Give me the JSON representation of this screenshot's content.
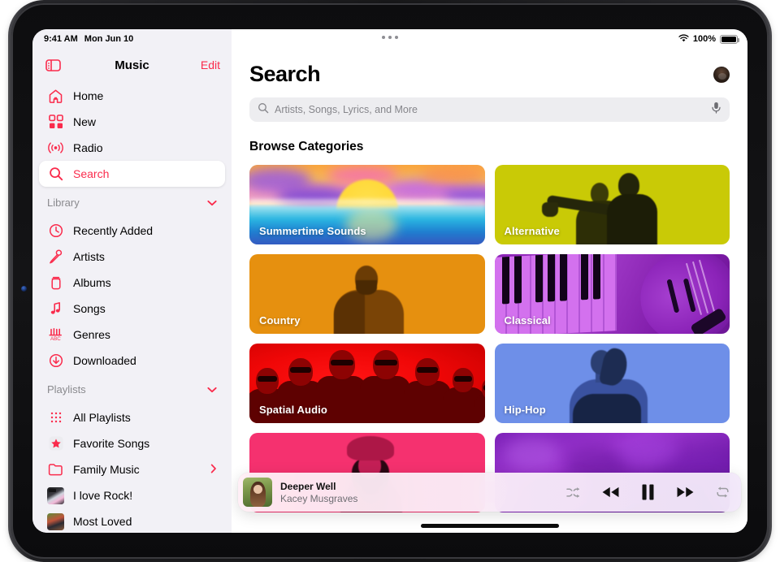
{
  "status_bar": {
    "time": "9:41 AM",
    "date": "Mon Jun 10",
    "battery_percent": "100%",
    "wifi_icon": "wifi-icon",
    "battery_icon": "battery-icon"
  },
  "sidebar": {
    "title": "Music",
    "edit_label": "Edit",
    "toggle_icon": "sidebar-toggle-icon",
    "primary_items": [
      {
        "label": "Home",
        "icon": "house-icon",
        "selected": false
      },
      {
        "label": "New",
        "icon": "grid-icon",
        "selected": false
      },
      {
        "label": "Radio",
        "icon": "radio-waves-icon",
        "selected": false
      },
      {
        "label": "Search",
        "icon": "search-icon",
        "selected": true
      }
    ],
    "library_section": {
      "label": "Library",
      "chevron_icon": "chevron-down-icon",
      "items": [
        {
          "label": "Recently Added",
          "icon": "clock-icon"
        },
        {
          "label": "Artists",
          "icon": "microphone-icon"
        },
        {
          "label": "Albums",
          "icon": "album-icon"
        },
        {
          "label": "Songs",
          "icon": "music-note-icon"
        },
        {
          "label": "Genres",
          "icon": "genres-icon"
        },
        {
          "label": "Downloaded",
          "icon": "download-arrow-icon"
        }
      ]
    },
    "playlists_section": {
      "label": "Playlists",
      "chevron_icon": "chevron-down-icon",
      "items": [
        {
          "label": "All Playlists",
          "icon": "playlist-grid-icon",
          "disclosure": false
        },
        {
          "label": "Favorite Songs",
          "icon": "star-icon",
          "disclosure": false
        },
        {
          "label": "Family Music",
          "icon": "folder-icon",
          "disclosure": true
        },
        {
          "label": "I love Rock!",
          "icon": "playlist-artwork",
          "disclosure": false
        },
        {
          "label": "Most Loved",
          "icon": "playlist-artwork",
          "disclosure": false
        }
      ]
    }
  },
  "main": {
    "page_title": "Search",
    "avatar_icon": "account-avatar",
    "search": {
      "placeholder": "Artists, Songs, Lyrics, and More",
      "value": "",
      "search_icon": "search-icon",
      "mic_icon": "microphone-icon"
    },
    "browse_heading": "Browse Categories",
    "categories": [
      {
        "label": "Summertime Sounds",
        "art": "summer",
        "color": "#f7a03c"
      },
      {
        "label": "Alternative",
        "art": "alt",
        "color": "#c9ca06"
      },
      {
        "label": "Country",
        "art": "country",
        "color": "#e6900f"
      },
      {
        "label": "Classical",
        "art": "classical",
        "color": "#8a23b5"
      },
      {
        "label": "Spatial Audio",
        "art": "spatial",
        "color": "#f00707"
      },
      {
        "label": "Hip-Hop",
        "art": "hiphop",
        "color": "#6e8fe8"
      },
      {
        "label": "",
        "art": "pop",
        "color": "#f5316f"
      },
      {
        "label": "",
        "art": "dance",
        "color": "#7d22b8"
      }
    ]
  },
  "mini_player": {
    "title": "Deeper Well",
    "artist": "Kacey Musgraves",
    "artwork_name": "album-artwork",
    "controls": [
      {
        "name": "shuffle-button",
        "icon": "shuffle-icon",
        "active": false
      },
      {
        "name": "rewind-button",
        "icon": "rewind-icon",
        "active": true
      },
      {
        "name": "pause-button",
        "icon": "pause-icon",
        "active": true
      },
      {
        "name": "fast-forward-button",
        "icon": "fast-forward-icon",
        "active": true
      },
      {
        "name": "repeat-button",
        "icon": "repeat-icon",
        "active": false
      }
    ]
  },
  "theme": {
    "accent": "#fa2b4c",
    "sidebar_bg": "#f2f1f6",
    "selected_bg": "#ffffff",
    "muted_text": "#8a8a8e"
  }
}
